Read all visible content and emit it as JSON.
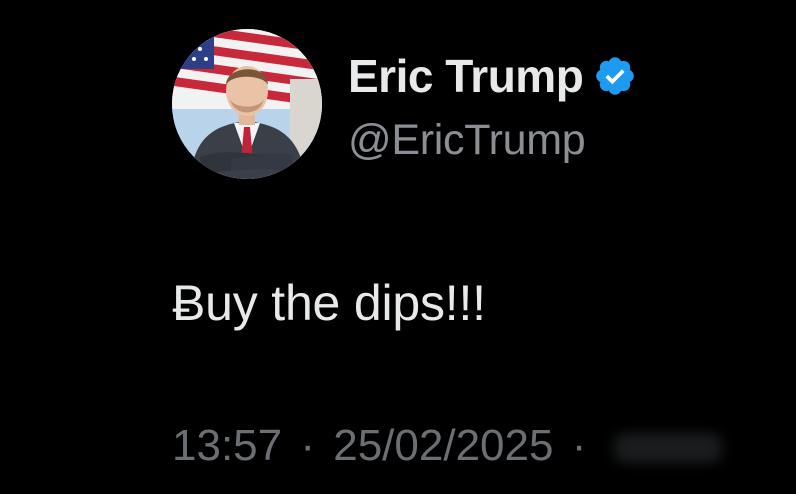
{
  "author": {
    "display_name": "Eric Trump",
    "handle": "@EricTrump",
    "verified_icon": "verified-badge-icon",
    "avatar_icon": "profile-photo"
  },
  "tweet": {
    "text": "Ƀuy the dips!!!"
  },
  "meta": {
    "time": "13:57",
    "separator": "·",
    "date": "25/02/2025"
  },
  "colors": {
    "background": "#000000",
    "primary_text": "#e7e9ea",
    "secondary_text": "#8b8f94",
    "verified_blue": "#1d9bf0"
  }
}
